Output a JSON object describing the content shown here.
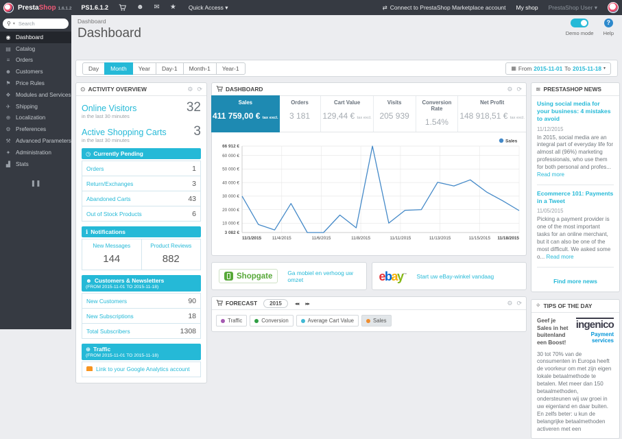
{
  "icons": {
    "gear": "⚙",
    "refresh": "⟳",
    "caret_down": "▾",
    "search": "⚲",
    "calendar": "▦",
    "person": "☻",
    "mail": "✉",
    "trophy": "★",
    "marketplace": "⇄",
    "activity": "⊙",
    "clock": "◷",
    "info": "ℹ",
    "customers": "☻",
    "globe": "⊕",
    "rss": "≋",
    "bulb": "✧",
    "rewind": "◂◂",
    "forward": "▸▸",
    "collapse": "❚❚",
    "dot": "●"
  },
  "topbar": {
    "brand_presta": "Presta",
    "brand_shop": "Shop",
    "brand_version": "1.6.1.2",
    "shop_name": "PS1.6.1.2",
    "quick_access": "Quick Access",
    "marketplace": "Connect to PrestaShop Marketplace account",
    "my_shop": "My shop",
    "user": "PrestaShop User"
  },
  "sidebar": {
    "search_placeholder": "Search",
    "items": [
      {
        "label": "Dashboard",
        "glyph": "◉"
      },
      {
        "label": "Catalog",
        "glyph": "▤"
      },
      {
        "label": "Orders",
        "glyph": "≡"
      },
      {
        "label": "Customers",
        "glyph": "☻"
      },
      {
        "label": "Price Rules",
        "glyph": "⚑"
      },
      {
        "label": "Modules and Services",
        "glyph": "❖"
      },
      {
        "label": "Shipping",
        "glyph": "✈"
      },
      {
        "label": "Localization",
        "glyph": "⊕"
      },
      {
        "label": "Preferences",
        "glyph": "⚙"
      },
      {
        "label": "Advanced Parameters",
        "glyph": "⚒"
      },
      {
        "label": "Administration",
        "glyph": "✦"
      },
      {
        "label": "Stats",
        "glyph": "▟"
      }
    ]
  },
  "page": {
    "breadcrumb": "Dashboard",
    "title": "Dashboard",
    "demo_mode": "Demo mode",
    "help": "Help"
  },
  "toolbar": {
    "buttons": [
      "Day",
      "Month",
      "Year",
      "Day-1",
      "Month-1",
      "Year-1"
    ],
    "active": "Month",
    "from_label": "From",
    "from_date": "2015-11-01",
    "to_label": "To",
    "to_date": "2015-11-18"
  },
  "activity": {
    "title": "ACTIVITY OVERVIEW",
    "online_visitors": {
      "label": "Online Visitors",
      "sub": "in the last 30 minutes",
      "value": "32"
    },
    "active_carts": {
      "label": "Active Shopping Carts",
      "sub": "in the last 30 minutes",
      "value": "3"
    },
    "pending": {
      "title": "Currently Pending",
      "rows": [
        {
          "label": "Orders",
          "value": "1"
        },
        {
          "label": "Return/Exchanges",
          "value": "3"
        },
        {
          "label": "Abandoned Carts",
          "value": "43"
        },
        {
          "label": "Out of Stock Products",
          "value": "6"
        }
      ]
    },
    "notifications": {
      "title": "Notifications",
      "cols": [
        {
          "label": "New Messages",
          "value": "144"
        },
        {
          "label": "Product Reviews",
          "value": "882"
        }
      ]
    },
    "customers": {
      "title": "Customers & Newsletters",
      "subtitle": "(FROM 2015-11-01 TO 2015-11-18)",
      "rows": [
        {
          "label": "New Customers",
          "value": "90"
        },
        {
          "label": "New Subscriptions",
          "value": "18"
        },
        {
          "label": "Total Subscribers",
          "value": "1308"
        }
      ]
    },
    "traffic": {
      "title": "Traffic",
      "subtitle": "(FROM 2015-11-01 TO 2015-11-18)",
      "link": "Link to your Google Analytics account"
    }
  },
  "dashboard": {
    "title": "DASHBOARD",
    "metrics": [
      {
        "label": "Sales",
        "value": "411 759,00 €",
        "suffix": "tax excl.",
        "active": true
      },
      {
        "label": "Orders",
        "value": "3 181",
        "suffix": ""
      },
      {
        "label": "Cart Value",
        "value": "129,44 €",
        "suffix": "tax excl."
      },
      {
        "label": "Visits",
        "value": "205 939",
        "suffix": ""
      },
      {
        "label": "Conversion Rate",
        "value": "1.54%",
        "suffix": ""
      },
      {
        "label": "Net Profit",
        "value": "148 918,51 €",
        "suffix": "tax excl."
      }
    ]
  },
  "chart_data": {
    "type": "line",
    "title": "Sales",
    "legend_position": "top-right",
    "grid": true,
    "x_dates": [
      "11/1/2015",
      "11/2/2015",
      "11/3/2015",
      "11/4/2015",
      "11/5/2015",
      "11/6/2015",
      "11/7/2015",
      "11/8/2015",
      "11/9/2015",
      "11/10/2015",
      "11/11/2015",
      "11/12/2015",
      "11/13/2015",
      "11/14/2015",
      "11/15/2015",
      "11/16/2015",
      "11/17/2015",
      "11/18/2015"
    ],
    "x_tick_labels": [
      "11/1/2015",
      "11/4/2015",
      "11/6/2015",
      "11/8/2015",
      "11/11/2015",
      "11/13/2015",
      "11/15/2015",
      "11/18/2015"
    ],
    "series": [
      {
        "name": "Sales",
        "color": "#4489c8",
        "values": [
          30000,
          9000,
          5000,
          24500,
          3100,
          3082,
          16000,
          6600,
          66912,
          10000,
          19500,
          20000,
          40200,
          37500,
          42000,
          33000,
          26500,
          19300
        ]
      }
    ],
    "ylim": [
      3082,
      66912
    ],
    "y_ticks": [
      {
        "v": 66912,
        "label": "66 912 €",
        "bold": true
      },
      {
        "v": 60000,
        "label": "60 000 €",
        "bold": false
      },
      {
        "v": 50000,
        "label": "50 000 €",
        "bold": false
      },
      {
        "v": 40000,
        "label": "40 000 €",
        "bold": false
      },
      {
        "v": 30000,
        "label": "30 000 €",
        "bold": false
      },
      {
        "v": 20000,
        "label": "20 000 €",
        "bold": false
      },
      {
        "v": 10000,
        "label": "10 000 €",
        "bold": false
      },
      {
        "v": 3082,
        "label": "3 082 €",
        "bold": true
      }
    ]
  },
  "banners": {
    "shopgate_name": "Shopgate",
    "shopgate_link": "Ga mobiel en verhoog uw omzet",
    "ebay_e": "e",
    "ebay_b": "b",
    "ebay_a": "a",
    "ebay_y": "y",
    "ebay_tm": "™",
    "ebay_colors": {
      "e": "#e53238",
      "b": "#0064d2",
      "a": "#f5af02",
      "y": "#86b817"
    },
    "ebay_link": "Start uw eBay-winkel vandaag"
  },
  "forecast": {
    "title": "FORECAST",
    "year": "2015",
    "legend": [
      {
        "label": "Traffic",
        "color": "#a55ab2",
        "active": false
      },
      {
        "label": "Conversion",
        "color": "#2f9e44",
        "active": false
      },
      {
        "label": "Average Cart Value",
        "color": "#41b9d5",
        "active": false
      },
      {
        "label": "Sales",
        "color": "#ef8d2e",
        "active": true
      }
    ]
  },
  "news": {
    "title": "PRESTASHOP NEWS",
    "articles": [
      {
        "title": "Using social media for your business: 4 mistakes to avoid",
        "date": "11/12/2015",
        "excerpt": "In 2015, social media are an integral part of everyday life for almost all (96%) marketing professionals, who use them for both personal and profes... ",
        "read_more": "Read more"
      },
      {
        "title": "Ecommerce 101: Payments in a Tweet",
        "date": "11/05/2015",
        "excerpt": "Picking a payment provider is one of the most important tasks for an online merchant, but it can also be one of the most difficult. We asked some o... ",
        "read_more": "Read more"
      }
    ],
    "more_link": "Find more news"
  },
  "tips": {
    "title": "TIPS OF THE DAY",
    "headline": "Geef je Sales in het buitenland een Boost!",
    "logo_main": "ingenico",
    "logo_sub_1": "Payment",
    "logo_sub_2": "services",
    "body": "30 tot 70% van de consumenten in Europa heeft de voorkeur om met zijn eigen lokale betaalmethode te betalen. Met meer dan 150 betaalmethoden, ondersteunen wij uw groei in uw eigenland en daar buiten. En zelfs beter: u kun de belangrijke betaalmethoden activeren met een"
  }
}
